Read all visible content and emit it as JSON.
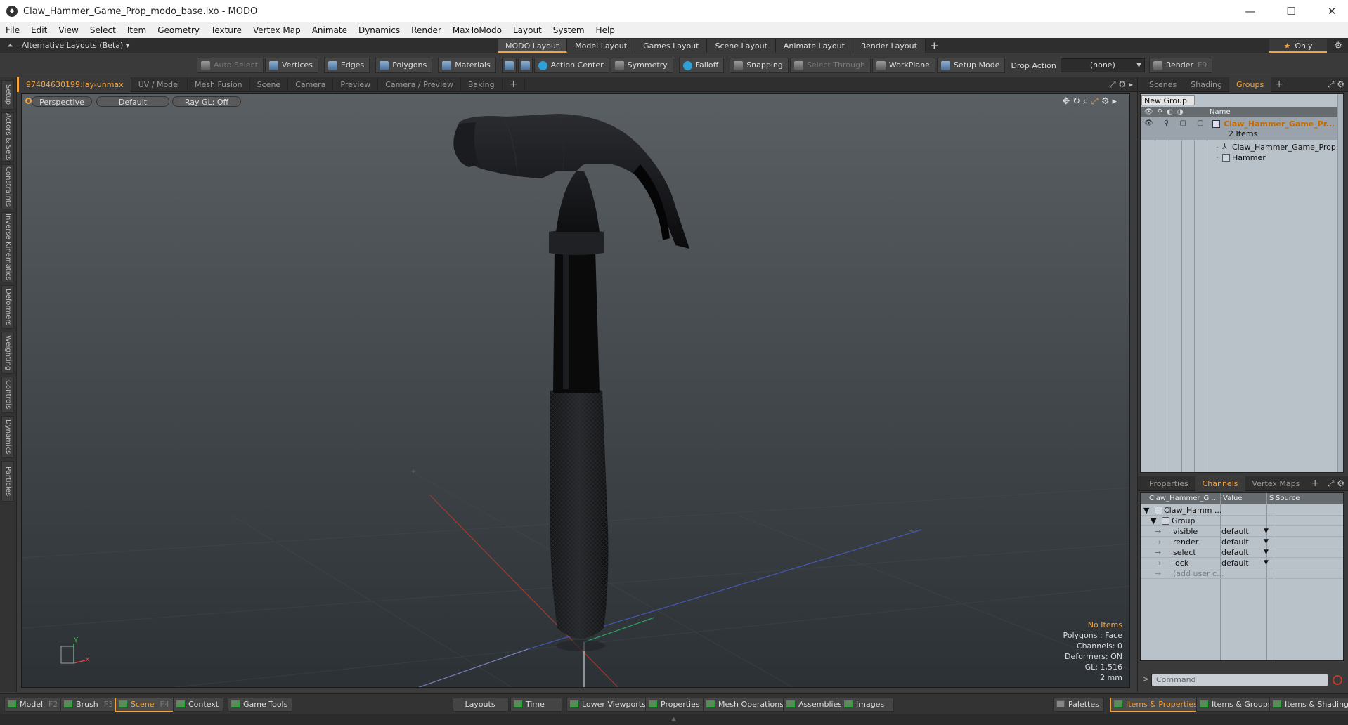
{
  "window": {
    "title": "Claw_Hammer_Game_Prop_modo_base.lxo - MODO",
    "app_icon": "modo-logo-icon",
    "controls": [
      "—",
      "☐",
      "✕"
    ]
  },
  "menu": [
    "File",
    "Edit",
    "View",
    "Select",
    "Item",
    "Geometry",
    "Texture",
    "Vertex Map",
    "Animate",
    "Dynamics",
    "Render",
    "MaxToModo",
    "Layout",
    "System",
    "Help"
  ],
  "layout_bar": {
    "alt_label": "Alternative Layouts (Beta)",
    "tabs": [
      "MODO Layout",
      "Model Layout",
      "Games Layout",
      "Scene Layout",
      "Animate Layout",
      "Render Layout"
    ],
    "active_tab": "MODO Layout",
    "plus": "+",
    "only_label": "Only"
  },
  "toolbar": {
    "auto_select": "Auto Select",
    "vertices": "Vertices",
    "edges": "Edges",
    "polygons": "Polygons",
    "materials": "Materials",
    "action_center": "Action Center",
    "symmetry": "Symmetry",
    "falloff": "Falloff",
    "snapping": "Snapping",
    "select_through": "Select Through",
    "workplane": "WorkPlane",
    "setup_mode": "Setup Mode",
    "drop_action_label": "Drop Action",
    "drop_action_value": "(none)",
    "render": "Render",
    "render_key": "F9"
  },
  "left_strip": [
    "Setup",
    "Actors & Sets",
    "Constraints",
    "Inverse Kinematics",
    "Deformers",
    "Weighting",
    "Controls",
    "Dynamics",
    "Particles"
  ],
  "viewport_tabs": {
    "tabs": [
      "97484630199:lay-unmax",
      "UV / Model",
      "Mesh Fusion",
      "Scene",
      "Camera",
      "Preview",
      "Camera / Preview",
      "Baking"
    ],
    "active": "97484630199:lay-unmax",
    "plus": "+"
  },
  "viewport": {
    "view_mode": "Perspective",
    "shading": "Default",
    "raygl": "Ray GL: Off",
    "info": {
      "items": "No Items",
      "polygons": "Polygons : Face",
      "channels": "Channels: 0",
      "deformers": "Deformers: ON",
      "gl": "GL: 1,516",
      "scale": "2 mm"
    },
    "axis_y": "Y",
    "axis_x": "X"
  },
  "groups_panel": {
    "tabs": [
      "Scenes",
      "Shading",
      "Groups"
    ],
    "active": "Groups",
    "new_group": "New Group",
    "name_header": "Name",
    "group_name": "Claw_Hammer_Game_Pr...",
    "group_count": "2 Items",
    "children": [
      "Claw_Hammer_Game_Prop",
      "Hammer"
    ]
  },
  "channels_panel": {
    "tabs": [
      "Properties",
      "Channels",
      "Vertex Maps"
    ],
    "active": "Channels",
    "headers": {
      "name": "Claw_Hammer_G ...",
      "value": "Value",
      "s": "S",
      "source": "Source"
    },
    "root": "Claw_Hamm ...",
    "group": "Group",
    "rows": [
      {
        "name": "visible",
        "value": "default"
      },
      {
        "name": "render",
        "value": "default"
      },
      {
        "name": "select",
        "value": "default"
      },
      {
        "name": "lock",
        "value": "default"
      }
    ],
    "add_user": "(add user c..."
  },
  "command": {
    "placeholder": "Command",
    "arrow": ">"
  },
  "bottom_bar": {
    "model": "Model",
    "model_key": "F2",
    "brush": "Brush",
    "brush_key": "F3",
    "scene": "Scene",
    "scene_key": "F4",
    "context": "Context",
    "game_tools": "Game Tools",
    "layouts": "Layouts",
    "time": "Time",
    "lower_viewports": "Lower Viewports",
    "properties": "Properties",
    "mesh_operations": "Mesh Operations",
    "assemblies": "Assemblies",
    "images": "Images",
    "palettes": "Palettes",
    "items_properties": "Items & Properties",
    "items_groups": "Items & Groups",
    "items_shading": "Items & Shading"
  },
  "colors": {
    "accent": "#f7a33c",
    "viewport_top": "#5a5f63",
    "viewport_bottom": "#2c3135",
    "panel_bg": "#b9c1c9"
  }
}
